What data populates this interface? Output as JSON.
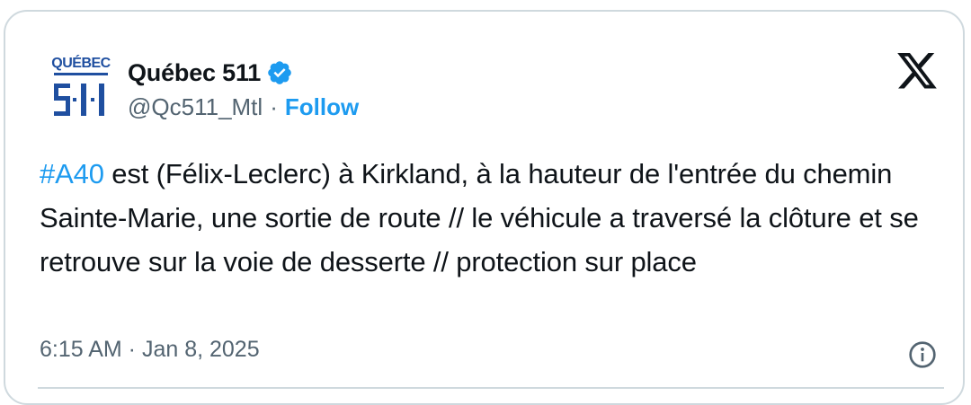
{
  "author": {
    "name": "Québec 511",
    "handle": "@Qc511_Mtl",
    "separator": "·",
    "follow_label": "Follow",
    "verified": true,
    "avatar": {
      "top_text": "QUÉBEC",
      "bottom_text": "511",
      "color": "#1f4fa0"
    }
  },
  "tweet": {
    "hashtag": "#A40",
    "text": " est (Félix-Leclerc) à Kirkland, à la hauteur de l'entrée du chemin Sainte-Marie, une sortie de route // le véhicule a traversé la clôture et se retrouve sur la voie de desserte // protection sur place",
    "timestamp": "6:15 AM · Jan 8, 2025"
  },
  "icons": {
    "verified": "verified-badge-icon",
    "platform": "x-logo-icon",
    "info": "info-icon"
  },
  "colors": {
    "accent": "#1d9bf0",
    "text": "#0f1419",
    "muted": "#536471",
    "border": "#cfd9de"
  }
}
